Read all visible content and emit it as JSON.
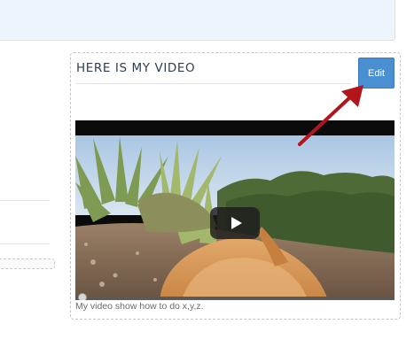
{
  "widget": {
    "title": "HERE IS MY VIDEO",
    "edit_label": "Edit",
    "caption": "My video show how to do x,y,z."
  },
  "video": {
    "play_icon": "play-icon",
    "progress": 0
  },
  "annotation": {
    "arrow_color": "#b2161c"
  },
  "colors": {
    "edit_button": "#4a8fd1",
    "top_panel": "#eef4fb",
    "title_text": "#2e3e55"
  }
}
